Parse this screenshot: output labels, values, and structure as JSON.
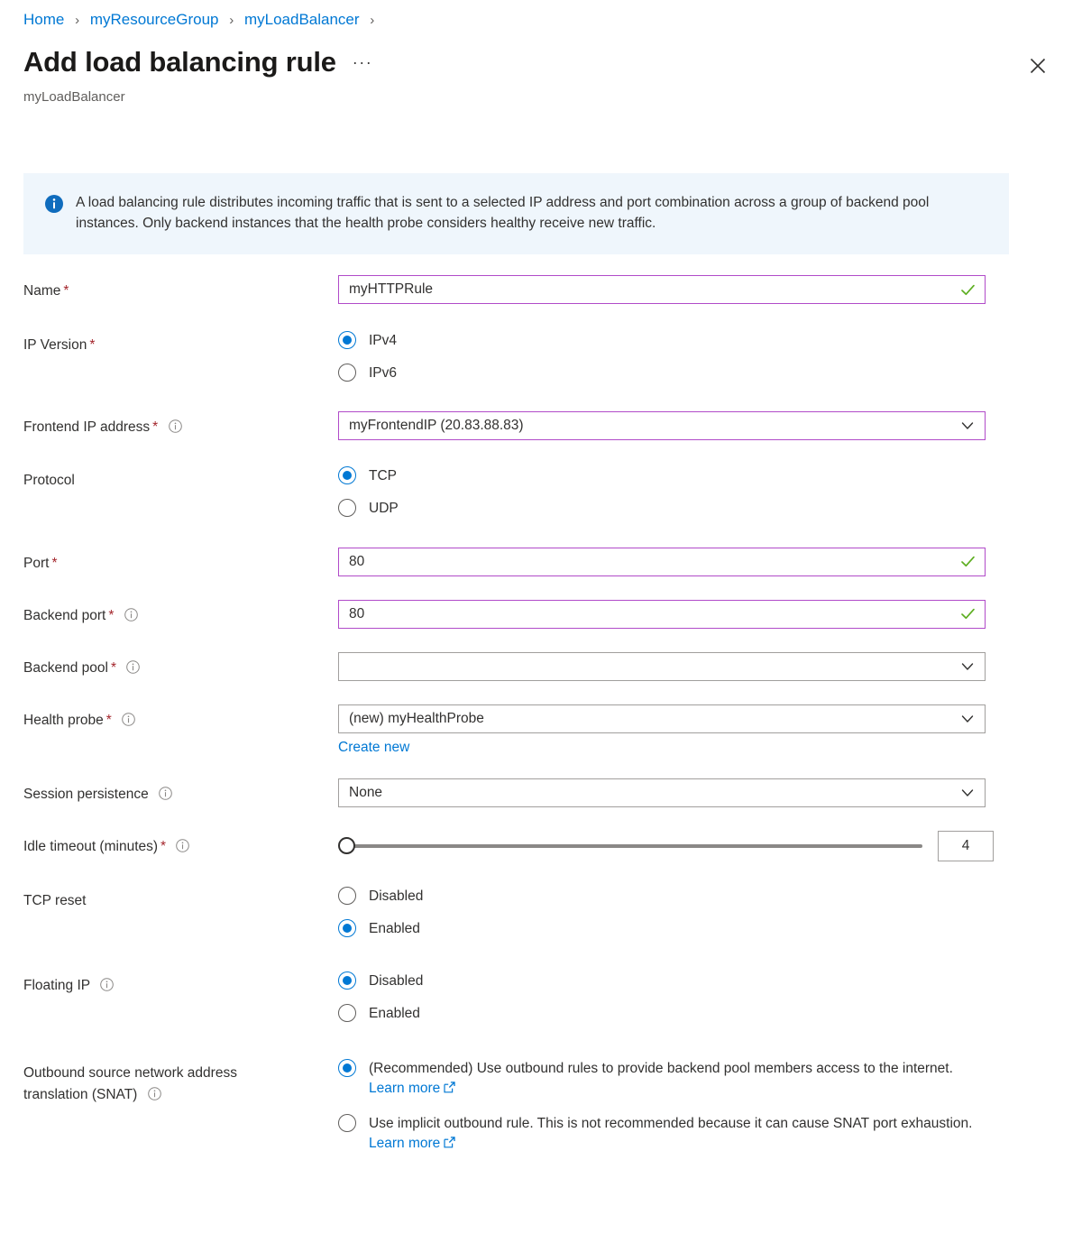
{
  "breadcrumb": {
    "items": [
      "Home",
      "myResourceGroup",
      "myLoadBalancer"
    ],
    "separator": "›"
  },
  "header": {
    "title": "Add load balancing rule",
    "subtitle": "myLoadBalancer",
    "ellipsis": "···",
    "close_label": "Close"
  },
  "info_banner": {
    "text": "A load balancing rule distributes incoming traffic that is sent to a selected IP address and port combination across a group of backend pool instances. Only backend instances that the health probe considers healthy receive new traffic."
  },
  "fields": {
    "name": {
      "label": "Name",
      "required": "*",
      "value": "myHTTPRule"
    },
    "ip_version": {
      "label": "IP Version",
      "required": "*",
      "options": [
        "IPv4",
        "IPv6"
      ],
      "selected": "IPv4"
    },
    "frontend_ip": {
      "label": "Frontend IP address",
      "required": "*",
      "value": "myFrontendIP (20.83.88.83)"
    },
    "protocol": {
      "label": "Protocol",
      "options": [
        "TCP",
        "UDP"
      ],
      "selected": "TCP"
    },
    "port": {
      "label": "Port",
      "required": "*",
      "value": "80"
    },
    "backend_port": {
      "label": "Backend port",
      "required": "*",
      "value": "80"
    },
    "backend_pool": {
      "label": "Backend pool",
      "required": "*",
      "value": ""
    },
    "health_probe": {
      "label": "Health probe",
      "required": "*",
      "value": "(new) myHealthProbe",
      "create_new": "Create new"
    },
    "session_persistence": {
      "label": "Session persistence",
      "value": "None"
    },
    "idle_timeout": {
      "label": "Idle timeout (minutes)",
      "required": "*",
      "value": "4",
      "min": 4,
      "max": 30
    },
    "tcp_reset": {
      "label": "TCP reset",
      "options": [
        "Disabled",
        "Enabled"
      ],
      "selected": "Enabled"
    },
    "floating_ip": {
      "label": "Floating IP",
      "options": [
        "Disabled",
        "Enabled"
      ],
      "selected": "Disabled"
    },
    "snat": {
      "label_line1": "Outbound source network address",
      "label_line2": "translation (SNAT)",
      "option1_text": "(Recommended) Use outbound rules to provide backend pool members access to the internet. ",
      "option1_link": "Learn more",
      "option2_text": "Use implicit outbound rule. This is not recommended because it can cause SNAT port exhaustion. ",
      "option2_link": "Learn more",
      "selected": "option1"
    }
  },
  "colors": {
    "link": "#0078d4",
    "required_asterisk": "#a4262c",
    "valid_border": "#b14bc9",
    "valid_check": "#5dae21",
    "info_bg": "#eff6fc",
    "radio_accent": "#0078d4"
  }
}
